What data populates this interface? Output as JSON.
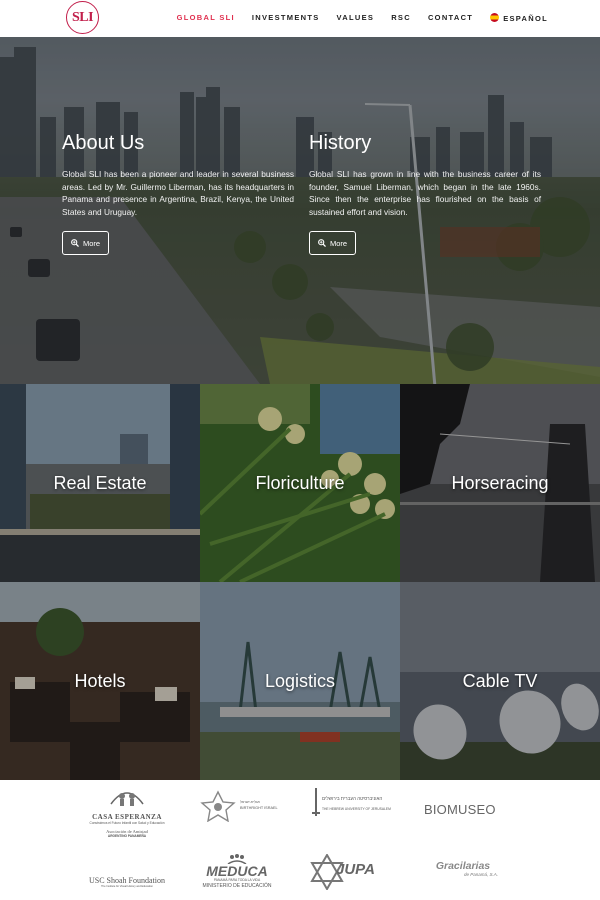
{
  "nav": {
    "logo_text": "SLI",
    "items": [
      {
        "label": "GLOBAL SLI",
        "active": true
      },
      {
        "label": "INVESTMENTS",
        "active": false
      },
      {
        "label": "VALUES",
        "active": false
      },
      {
        "label": "RSC",
        "active": false
      },
      {
        "label": "CONTACT",
        "active": false
      },
      {
        "label": "ESPAÑOL",
        "active": false,
        "icon": "spain-flag-icon"
      }
    ]
  },
  "hero": {
    "about": {
      "title": "About Us",
      "text": "Global SLI has been a pioneer and leader in several business areas. Led by Mr. Guillermo Liberman, has its headquarters in Panama and presence in Argentina, Brazil, Kenya, the United States and Uruguay.",
      "button": "More"
    },
    "history": {
      "title": "History",
      "text": "Global SLI has grown in line with the business career of its founder, Samuel Liberman, which began in the late 1960s. Since then the enterprise has flourished on the basis of sustained effort and vision.",
      "button": "More"
    }
  },
  "tiles": [
    {
      "label": "Real Estate"
    },
    {
      "label": "Floriculture"
    },
    {
      "label": "Horseracing"
    },
    {
      "label": "Hotels"
    },
    {
      "label": "Logistics"
    },
    {
      "label": "Cable TV"
    }
  ],
  "partners": {
    "casa": {
      "name": "CASA ESPERANZA",
      "sub1": "Construimos el Futuro Infantil con Salud y Educación",
      "sub2": "Asociación de Amistad",
      "sub3": "ARGENTINO PANAMEÑA"
    },
    "taglit": {
      "line1": "תגלית-ישראל",
      "line2": "BIRTHRIGHT ISRAEL"
    },
    "hebrew": {
      "line1": "האוניברסיטה העברית בירושלים",
      "line2": "THE HEBREW UNIVERSITY OF JERUSALEM"
    },
    "biomuseo": {
      "name": "BIOMUSEO"
    },
    "usc": {
      "name": "USC Shoah Foundation",
      "sub": "The Institute for Visual History and Education"
    },
    "meduca": {
      "name": "MEDUCA",
      "sub1": "PANAMÁ PARA TODA LA VIDA",
      "sub2": "MINISTERIO DE EDUCACIÓN"
    },
    "jupa": {
      "name": "JUPA"
    },
    "gracilarias": {
      "name": "Gracilarias",
      "sub": "de Panamá, S.A."
    }
  }
}
